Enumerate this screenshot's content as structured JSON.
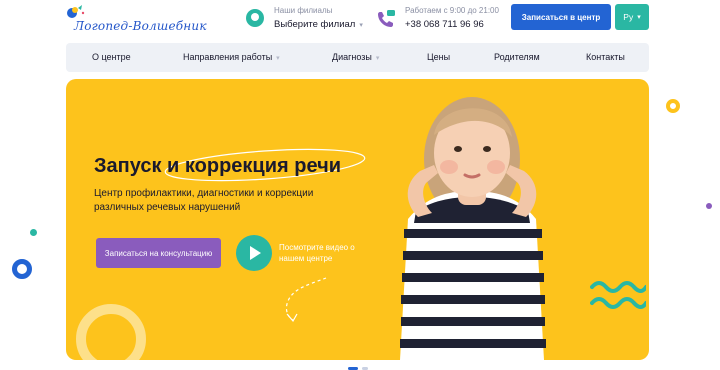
{
  "header": {
    "logo_text": "Логопед-Волшебник",
    "branch": {
      "caption": "Наши филиалы",
      "select_label": "Выберите филиал"
    },
    "phone": {
      "caption": "Работаем с 9:00 до 21:00",
      "number": "+38 068 711 96 96"
    },
    "signup_label": "Записаться в центр",
    "language": "Ру",
    "icons": {
      "logo": "logo-icon",
      "branch": "location-pin-icon",
      "phone": "phone-icon",
      "chevron": "chevron-down-icon"
    }
  },
  "nav": {
    "items": [
      {
        "label": "О центре"
      },
      {
        "label": "Направления работы"
      },
      {
        "label": "Диагнозы"
      },
      {
        "label": "Цены"
      },
      {
        "label": "Родителям"
      },
      {
        "label": "Контакты"
      }
    ]
  },
  "hero": {
    "title_part1": "Запуск и ",
    "title_part2": "коррекция речи",
    "subtitle": "Центр профилактики, диагностики и коррекции различных речевых нарушений",
    "cta_label": "Записаться на консультацию",
    "video_label": "Посмотрите видео о нашем центре",
    "icons": {
      "play": "play-icon"
    }
  },
  "colors": {
    "accent_blue": "#2364d3",
    "accent_teal": "#2ab7a3",
    "hero_yellow": "#fdc31c",
    "cta_purple": "#8a5cbd",
    "nav_bg": "#eef1f6"
  }
}
